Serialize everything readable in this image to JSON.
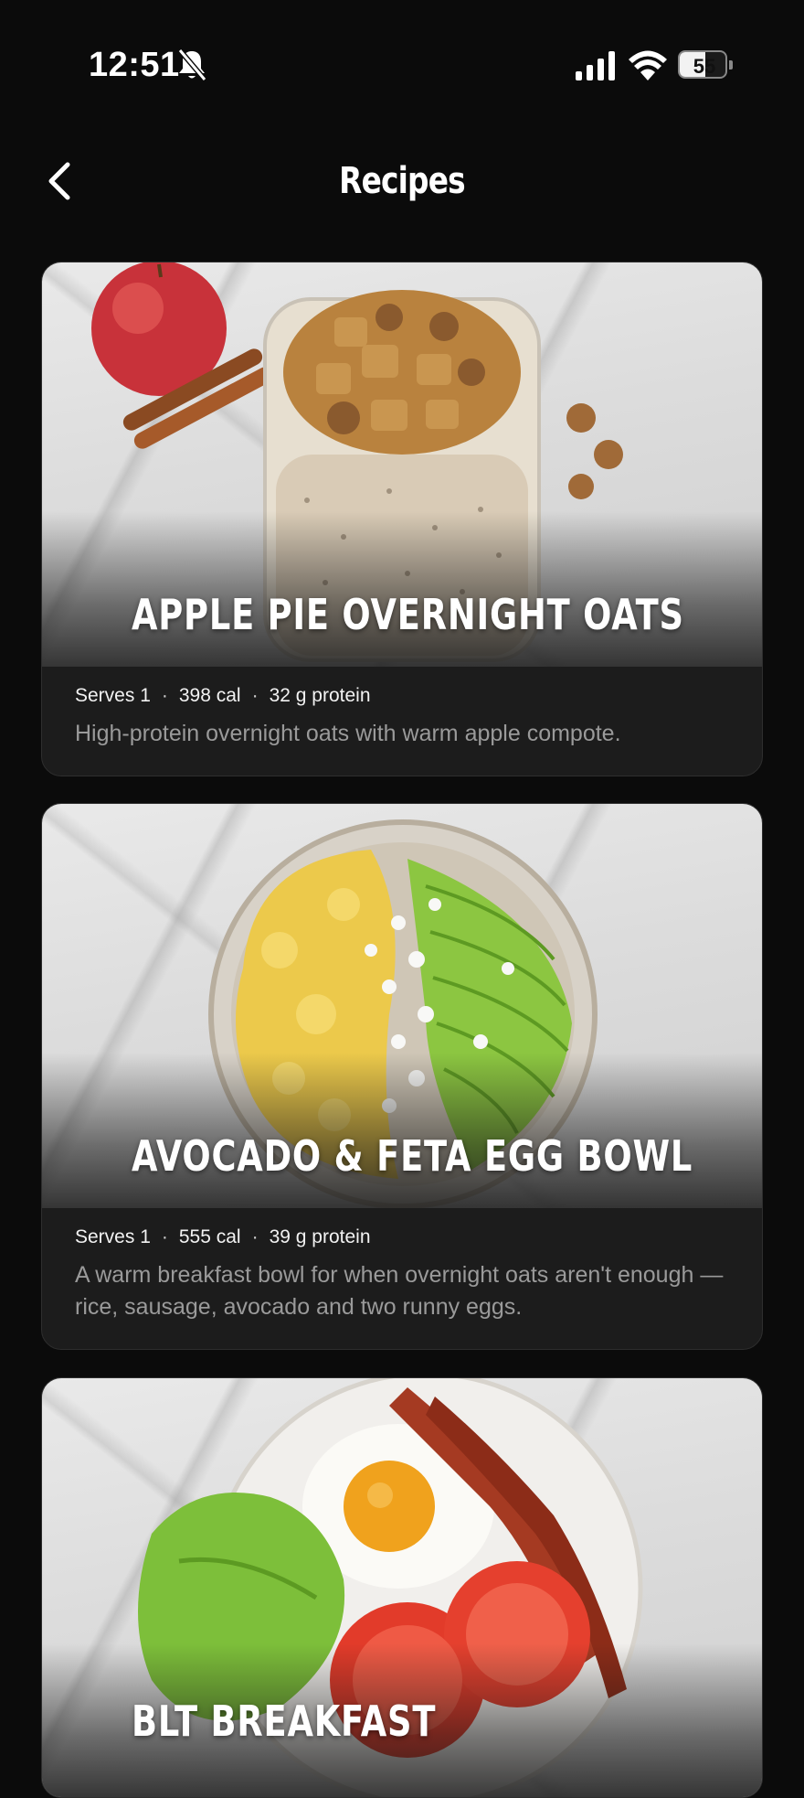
{
  "status_bar": {
    "time": "12:51",
    "battery": "55",
    "battery_level": 0.55
  },
  "header": {
    "title": "Recipes"
  },
  "icons": [
    "bell-slash-icon",
    "signal-icon",
    "wifi-icon",
    "battery-icon",
    "chevron-left-icon"
  ],
  "recipes": [
    {
      "title": "APPLE PIE OVERNIGHT OATS",
      "serves": "Serves 1",
      "calories": "398 cal",
      "protein": "32 g protein",
      "description": "High-protein overnight oats with warm apple compote."
    },
    {
      "title": "AVOCADO & FETA EGG BOWL",
      "serves": "Serves 1",
      "calories": "555 cal",
      "protein": "39 g protein",
      "description": "A warm breakfast bowl for when overnight oats aren't enough — rice, sausage, avocado and two runny eggs."
    },
    {
      "title": "BLT BREAKFAST"
    }
  ],
  "separator": "·"
}
